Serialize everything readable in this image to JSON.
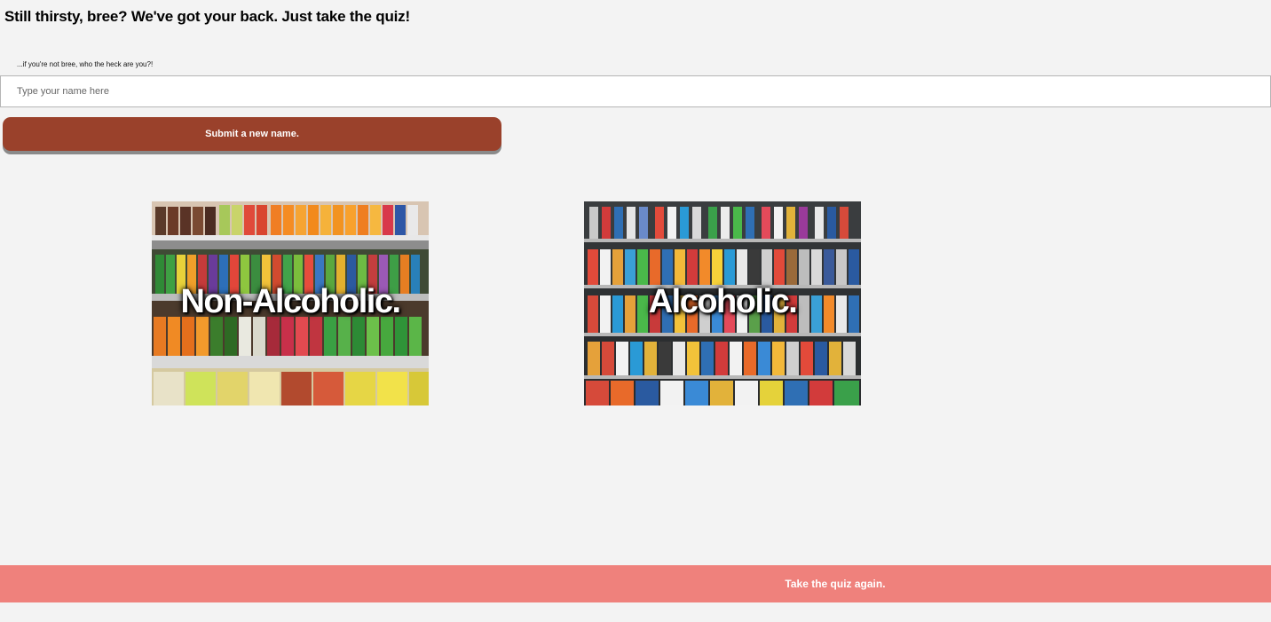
{
  "header": {
    "headline": "Still thirsty, bree? We've got your back. Just take the quiz!"
  },
  "name_form": {
    "note": "...if you're not bree, who the heck are you?!",
    "input_placeholder": "Type your name here",
    "input_value": "",
    "submit_label": "Submit a new name."
  },
  "choices": [
    {
      "label": "Non-Alcoholic."
    },
    {
      "label": "Alcoholic."
    }
  ],
  "footer": {
    "retake_label": "Take the quiz again."
  },
  "colors": {
    "page_bg": "#f3f3f3",
    "submit_button": "#9a412b",
    "retake_bar": "#ef817c",
    "text": "#000000"
  },
  "icons": {
    "nonalcoholic_image": "soda-shelf-image",
    "alcoholic_image": "beer-shelf-image"
  }
}
